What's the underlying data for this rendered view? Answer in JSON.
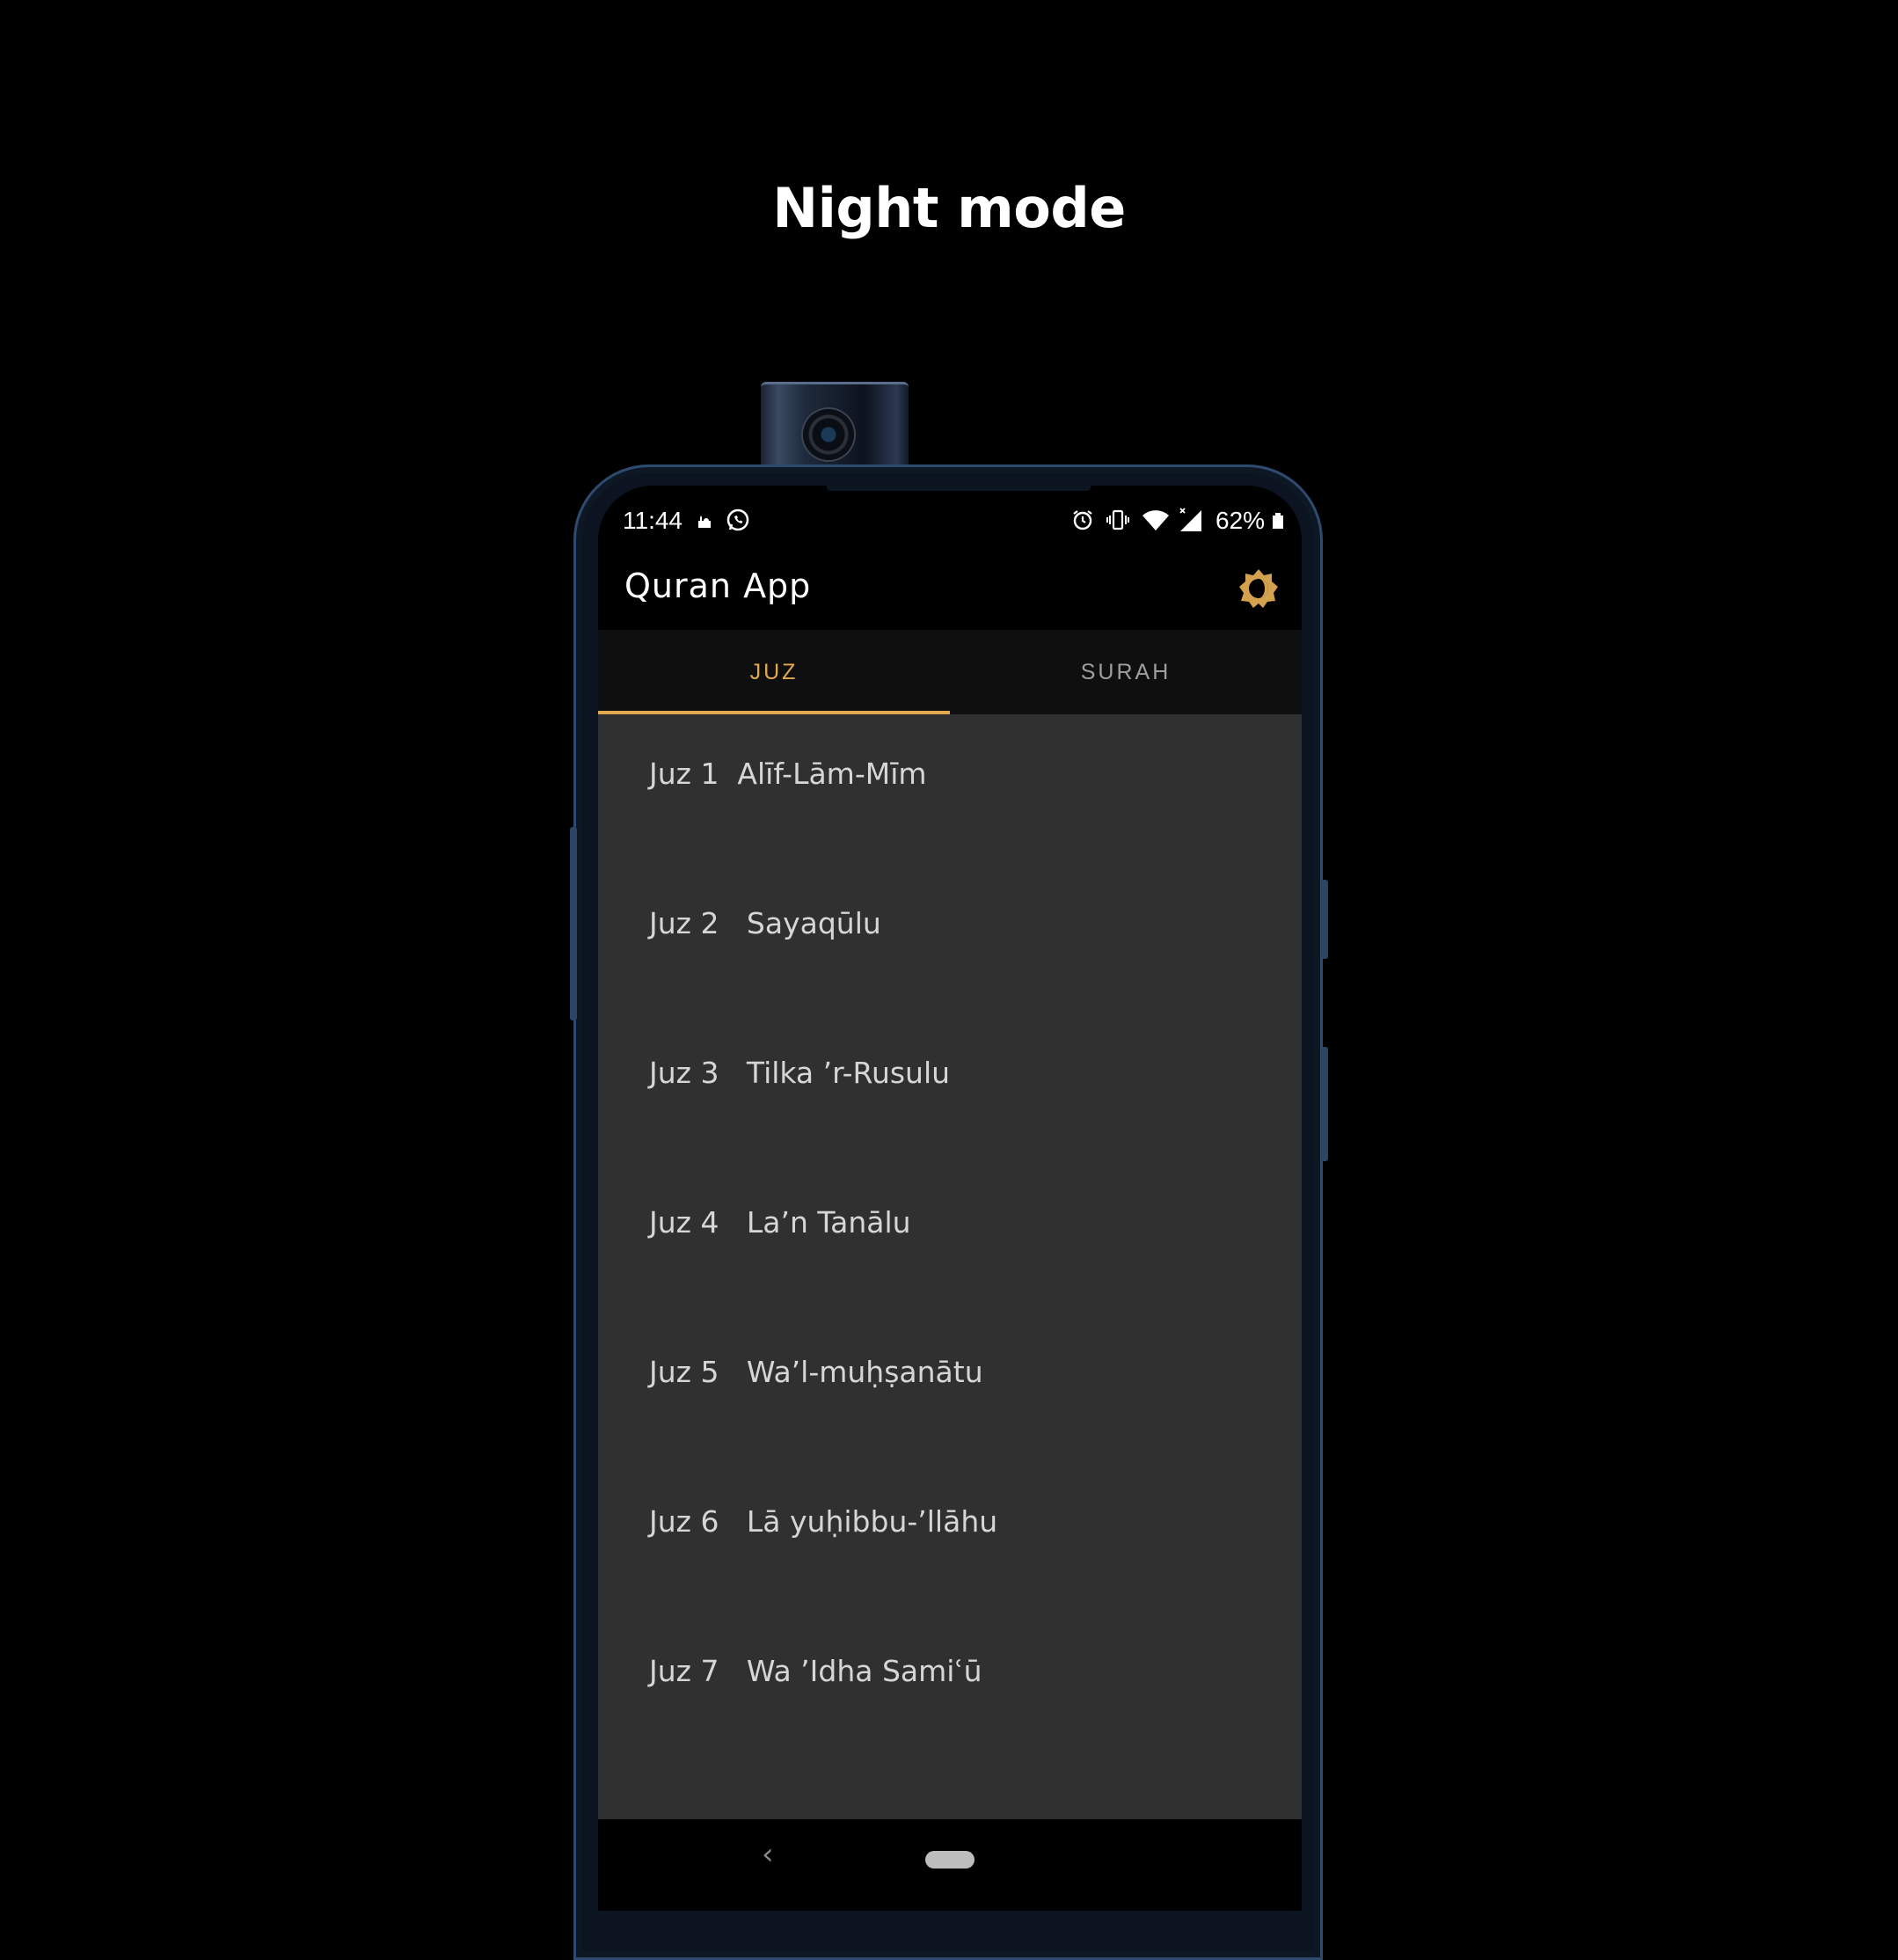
{
  "headline": "Night mode",
  "status_bar": {
    "time": "11:44",
    "battery": "62%",
    "icons": [
      "mosque-icon",
      "whatsapp-icon",
      "alarm-icon",
      "vibrate-icon",
      "wifi-icon",
      "signal-icon",
      "battery-icon"
    ]
  },
  "app": {
    "title": "Quran App",
    "theme_toggle_icon": "theme-brightness-icon",
    "accent": "#e0a94f",
    "background": "#303030"
  },
  "tabs": [
    {
      "label": "JUZ",
      "active": true
    },
    {
      "label": "SURAH",
      "active": false
    }
  ],
  "juz_list": [
    {
      "label": "Juz 1  Alīf-Lām-Mīm"
    },
    {
      "label": "Juz 2   Sayaqūlu"
    },
    {
      "label": "Juz 3   Tilka ’r-Rusulu"
    },
    {
      "label": "Juz 4   La’n Tanālu"
    },
    {
      "label": "Juz 5   Wa’l-muḥṣanātu"
    },
    {
      "label": "Juz 6   Lā yuḥibbu-’llāhu"
    },
    {
      "label": "Juz 7   Wa ’Idha Samiʿū"
    }
  ],
  "nav": {
    "back_icon": "‹"
  }
}
